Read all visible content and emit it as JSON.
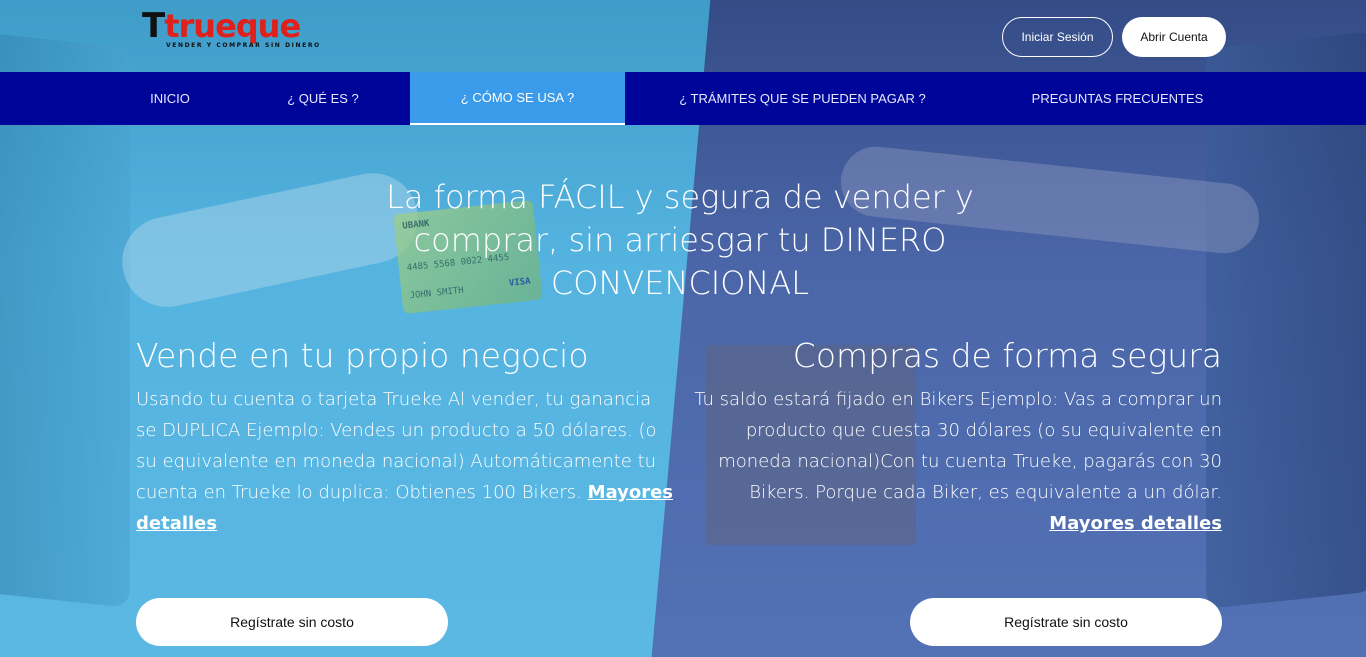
{
  "brand": {
    "logo_letter": "T",
    "logo_name": "trueque",
    "tagline": "VENDER Y COMPRAR SIN DINERO"
  },
  "header": {
    "login_label": "Iniciar Sesión",
    "open_account_label": "Abrir Cuenta"
  },
  "nav": {
    "items": [
      {
        "label": "INICIO"
      },
      {
        "label": "¿ QUÉ ES ?"
      },
      {
        "label": "¿ CÓMO SE USA ?"
      },
      {
        "label": "¿ TRÁMITES QUE SE PUEDEN PAGAR ?"
      },
      {
        "label": "PREGUNTAS FRECUENTES"
      }
    ],
    "active_index": 2
  },
  "hero": {
    "title": "La forma FÁCIL y segura de vender y comprar, sin arriesgar tu DINERO CONVENCIONAL"
  },
  "decor": {
    "card_bank": "UBANK",
    "card_number": "4485 5568 0022 4455",
    "card_name": "JOHN SMITH",
    "card_brand": "VISA"
  },
  "sell": {
    "title": "Vende en tu propio negocio",
    "text": "Usando tu cuenta o tarjeta Trueke Al vender, tu ganancia se DUPLICA Ejemplo: Vendes un producto a 50 dólares. (o su equivalente en moneda nacional) Automáticamente tu cuenta en Trueke lo duplica: Obtienes 100 Bikers.",
    "link": "Mayores detalles",
    "button": "Regístrate sin costo"
  },
  "buy": {
    "title": "Compras de forma segura",
    "text": "Tu saldo estará fijado en Bikers Ejemplo: Vas a comprar un producto que cuesta 30 dólares (o su equivalente en moneda nacional)Con tu cuenta Trueke, pagarás con 30 Bikers. Porque cada Biker, es equivalente a un dólar.",
    "link": "Mayores detalles",
    "button": "Regístrate sin costo"
  }
}
